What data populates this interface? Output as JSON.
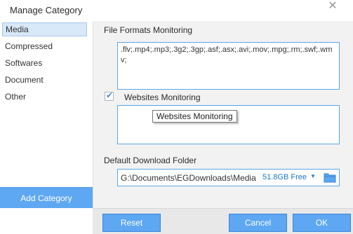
{
  "window": {
    "title": "Manage Category",
    "close_glyph": "✕"
  },
  "sidebar": {
    "items": [
      {
        "label": "Media",
        "selected": true
      },
      {
        "label": "Compressed",
        "selected": false
      },
      {
        "label": "Softwares",
        "selected": false
      },
      {
        "label": "Document",
        "selected": false
      },
      {
        "label": "Other",
        "selected": false
      }
    ],
    "add_button": "Add Category"
  },
  "main": {
    "file_formats": {
      "label": "File Formats Monitoring",
      "value": ".flv;.mp4;.mp3;.3g2;.3gp;.asf;.asx;.avi;.mov;.mpg;.rm;.swf;.wmv;"
    },
    "websites": {
      "label": "Websites Monitoring",
      "checked": true,
      "check_glyph": "✔",
      "value": "",
      "tooltip": "Websites Monitoring"
    },
    "download_folder": {
      "label": "Default Download Folder",
      "path": "G:\\Documents\\EGDownloads\\Media",
      "free_space": "51.8GB Free",
      "caret_glyph": "▼",
      "folder_icon": "folder-icon"
    }
  },
  "buttons": {
    "reset": "Reset",
    "cancel": "Cancel",
    "ok": "OK"
  },
  "colors": {
    "accent": "#5da7f3",
    "free_space_text": "#1e78c8",
    "selection_bg": "#d7e8f8"
  }
}
